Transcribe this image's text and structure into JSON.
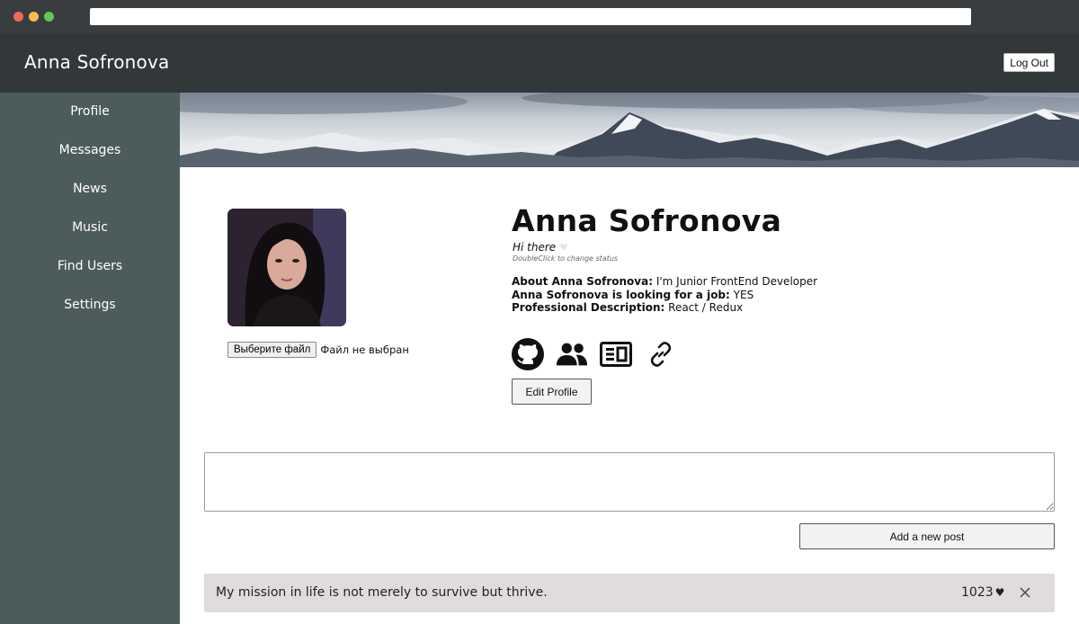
{
  "header": {
    "brand": "Anna Sofronova",
    "logout_label": "Log Out"
  },
  "sidebar": {
    "items": [
      {
        "label": "Profile"
      },
      {
        "label": "Messages"
      },
      {
        "label": "News"
      },
      {
        "label": "Music"
      },
      {
        "label": "Find Users"
      },
      {
        "label": "Settings"
      }
    ]
  },
  "profile": {
    "name": "Anna Sofronova",
    "status": "Hi there",
    "status_hint": "DoubleClick to change status",
    "about_label": "About Anna Sofronova:",
    "about_value": "I'm Junior FrontEnd Developer",
    "job_label": "Anna Sofronova is looking for a job:",
    "job_value": "YES",
    "description_label": "Professional Description:",
    "description_value": "React / Redux",
    "file_button_label": "Выберите файл",
    "file_status": "Файл не выбран",
    "edit_label": "Edit Profile",
    "social_icons": [
      "github-icon",
      "users-icon",
      "news-icon",
      "link-icon"
    ]
  },
  "posts": {
    "add_label": "Add a new post",
    "items": [
      {
        "text": "My mission in life is not merely to survive but thrive.",
        "likes": "1023"
      }
    ]
  },
  "colors": {
    "header": "#323739",
    "sidebar": "#4c5b5c",
    "post_bg": "#e0dcdc"
  }
}
